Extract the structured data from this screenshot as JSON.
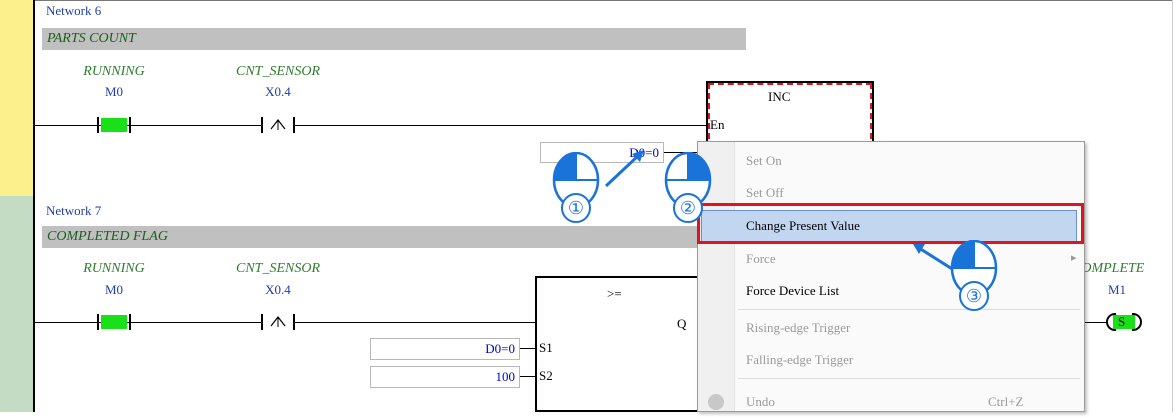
{
  "networks": [
    {
      "label": "Network 6",
      "comment": "PARTS COUNT",
      "contact1": {
        "name": "RUNNING",
        "addr": "M0"
      },
      "contact2": {
        "name": "CNT_SENSOR",
        "addr": "X0.4"
      },
      "block": {
        "title": "INC",
        "en_pin": "En"
      },
      "input_value": "D0=0"
    },
    {
      "label": "Network 7",
      "comment": "COMPLETED FLAG",
      "contact1": {
        "name": "RUNNING",
        "addr": "M0"
      },
      "contact2": {
        "name": "CNT_SENSOR",
        "addr": "X0.4"
      },
      "block": {
        "title": ">=",
        "out_pin": "Q",
        "pins": [
          "S1",
          "S2"
        ]
      },
      "inputs": [
        "D0=0",
        "100"
      ],
      "coil": {
        "name": "COMPLETE",
        "addr": "M1",
        "symbol": "S"
      }
    }
  ],
  "context_menu": {
    "items": [
      {
        "label": "Set On",
        "enabled": false
      },
      {
        "label": "Set Off",
        "enabled": false
      },
      {
        "label": "Change Present Value",
        "enabled": true,
        "highlighted": true
      },
      {
        "label": "Force",
        "enabled": false,
        "submenu": true
      },
      {
        "label": "Force Device List",
        "enabled": true
      },
      {
        "label": "Rising-edge Trigger",
        "enabled": false
      },
      {
        "label": "Falling-edge Trigger",
        "enabled": false
      },
      {
        "label": "Undo",
        "enabled": false,
        "shortcut": "Ctrl+Z",
        "icon": "undo-icon"
      }
    ],
    "submenu_arrow": "▸"
  },
  "steps": [
    "①",
    "②",
    "③"
  ],
  "colors": {
    "contact_on": "#19e019",
    "highlight": "#c3d6f0",
    "callout_blue": "#1a73d9",
    "callout_red": "#e0141f"
  }
}
